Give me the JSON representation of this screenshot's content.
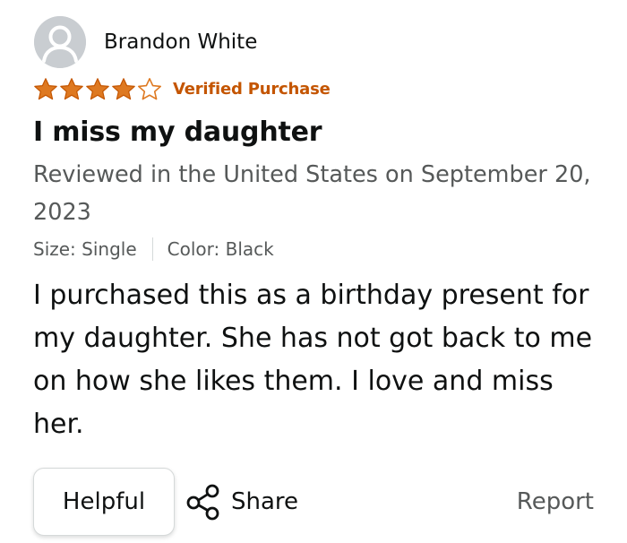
{
  "reviewer": {
    "name": "Brandon White",
    "avatar_icon": "user-silhouette-icon"
  },
  "rating": {
    "value": 4,
    "max": 5,
    "filled_color": "#de7921",
    "empty_color": "#de7921"
  },
  "badge": {
    "label": "Verified Purchase",
    "color": "#c45500"
  },
  "review": {
    "title": "I miss my daughter",
    "reviewed_line": "Reviewed in the United States on September 20, 2023",
    "size": "Size: Single",
    "color": "Color: Black",
    "body": "I purchased this as a birthday present for my daughter. She has not got back to me on how she likes them. I love and miss her."
  },
  "actions": {
    "helpful_label": "Helpful",
    "share_label": "Share",
    "share_icon": "share-icon",
    "report_label": "Report"
  }
}
